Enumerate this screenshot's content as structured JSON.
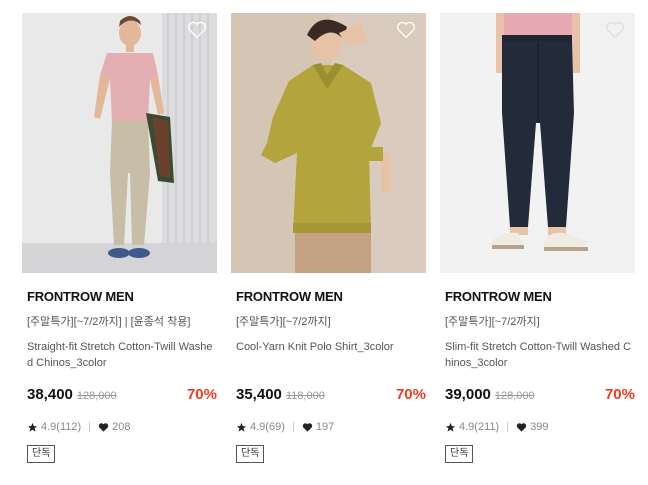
{
  "products": [
    {
      "brand": "FRONTROW MEN",
      "promo": "[주말특가][~7/2까지] | [윤종석 착용]",
      "name": "Straight-fit Stretch Cotton-Twill Washed Chinos_3color",
      "price": "38,400",
      "original_price": "128,000",
      "discount": "70%",
      "rating": "4.9(112)",
      "likes": "208",
      "badge": "단독",
      "heart_icon": "heart-outline-icon"
    },
    {
      "brand": "FRONTROW MEN",
      "promo": "[주말특가][~7/2까지]",
      "name": "Cool-Yarn Knit Polo Shirt_3color",
      "price": "35,400",
      "original_price": "118,000",
      "discount": "70%",
      "rating": "4.9(69)",
      "likes": "197",
      "badge": "단독",
      "heart_icon": "heart-outline-icon"
    },
    {
      "brand": "FRONTROW MEN",
      "promo": "[주말특가][~7/2까지]",
      "name": "Slim-fit Stretch Cotton-Twill Washed Chinos_3color",
      "price": "39,000",
      "original_price": "128,000",
      "discount": "70%",
      "rating": "4.9(211)",
      "likes": "399",
      "badge": "단독",
      "heart_icon": "heart-outline-icon"
    }
  ],
  "colors": {
    "discount": "#f03c20",
    "price": "#111111",
    "muted": "#888888"
  }
}
